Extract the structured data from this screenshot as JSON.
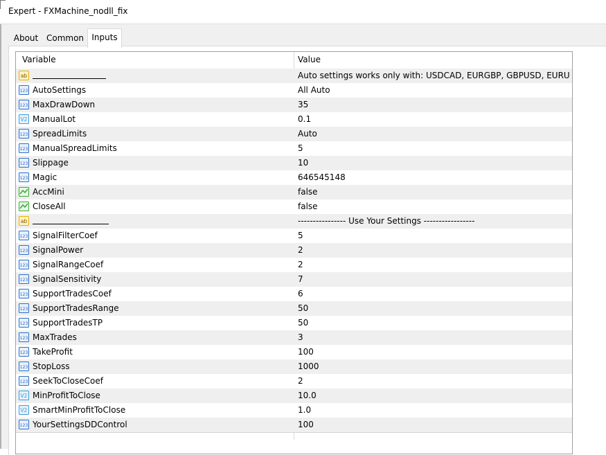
{
  "window": {
    "title": "Expert - FXMachine_nodll_fix"
  },
  "tabs": [
    {
      "label": "About"
    },
    {
      "label": "Common"
    },
    {
      "label": "Inputs"
    }
  ],
  "table": {
    "headers": {
      "variable": "Variable",
      "value": "Value"
    },
    "rows": [
      {
        "name": "",
        "underline": true,
        "value": "Auto settings works only with: USDCAD, EURGBP, GBPUSD, EURU...",
        "type": "ab"
      },
      {
        "name": "AutoSettings",
        "value": "All Auto",
        "type": "123"
      },
      {
        "name": "MaxDrawDown",
        "value": "35",
        "type": "123"
      },
      {
        "name": "ManualLot",
        "value": "0.1",
        "type": "v2"
      },
      {
        "name": "SpreadLimits",
        "value": "Auto",
        "type": "123"
      },
      {
        "name": "ManualSpreadLimits",
        "value": "5",
        "type": "123"
      },
      {
        "name": "Slippage",
        "value": "10",
        "type": "123"
      },
      {
        "name": "Magic",
        "value": "646545148",
        "type": "123"
      },
      {
        "name": "AccMini",
        "value": "false",
        "type": "bool"
      },
      {
        "name": "CloseAll",
        "value": "false",
        "type": "bool"
      },
      {
        "name": "",
        "underline": true,
        "value": "---------------- Use Your Settings -----------------",
        "type": "ab"
      },
      {
        "name": "SignalFilterCoef",
        "value": "5",
        "type": "123"
      },
      {
        "name": "SignalPower",
        "value": "2",
        "type": "123"
      },
      {
        "name": "SignalRangeCoef",
        "value": "2",
        "type": "123"
      },
      {
        "name": "SignalSensitivity",
        "value": "7",
        "type": "123"
      },
      {
        "name": "SupportTradesCoef",
        "value": "6",
        "type": "123"
      },
      {
        "name": "SupportTradesRange",
        "value": "50",
        "type": "123"
      },
      {
        "name": "SupportTradesTP",
        "value": "50",
        "type": "123"
      },
      {
        "name": "MaxTrades",
        "value": "3",
        "type": "123"
      },
      {
        "name": "TakeProfit",
        "value": "100",
        "type": "123"
      },
      {
        "name": "StopLoss",
        "value": "1000",
        "type": "123"
      },
      {
        "name": "SeekToCloseCoef",
        "value": "2",
        "type": "123"
      },
      {
        "name": "MinProfitToClose",
        "value": "10.0",
        "type": "v2"
      },
      {
        "name": "SmartMinProfitToClose",
        "value": "1.0",
        "type": "v2"
      },
      {
        "name": "YourSettingsDDControl",
        "value": "100",
        "type": "123"
      }
    ]
  },
  "icons": {
    "ab": {
      "name": "string-type-icon",
      "text": "ab",
      "color": "#e8b000"
    },
    "123": {
      "name": "integer-type-icon",
      "text": "123",
      "color": "#2f6fc6"
    },
    "v2": {
      "name": "double-type-icon",
      "text": "V2",
      "color": "#3a9fd8"
    },
    "bool": {
      "name": "boolean-type-icon",
      "text": "",
      "color": "#3aa63a"
    }
  },
  "colors": {
    "row_alt": "#efefef",
    "row": "#ffffff"
  }
}
